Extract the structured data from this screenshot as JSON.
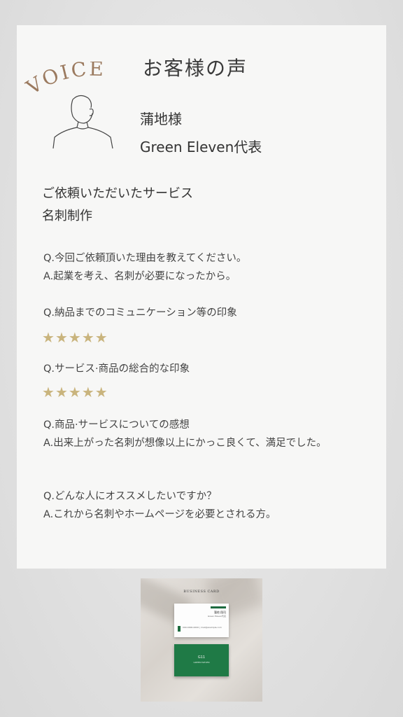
{
  "header": {
    "voice_label": "VOICE",
    "title": "お客様の声"
  },
  "customer": {
    "name": "蒲地様",
    "organization": "Green Eleven代表"
  },
  "service": {
    "label": "ご依頼いただいたサービス",
    "value": "名刺制作"
  },
  "qa": [
    {
      "question": "Q.今回ご依頼頂いた理由を教えてください。",
      "answer": "A.起業を考え、名刺が必要になったから。"
    },
    {
      "question": "Q.納品までのコミュニケーション等の印象",
      "rating": 5
    },
    {
      "question": "Q.サービス·商品の総合的な印象",
      "rating": 5
    },
    {
      "question": "Q.商品·サービスについての感想",
      "answer": "A.出来上がった名刺が想像以上にかっこ良くて、満足でした。"
    },
    {
      "question": "Q.どんな人にオススメしたいですか？",
      "answer": "A.これから名刺やホームページを必要とされる方。"
    }
  ],
  "rating_scale": 5,
  "star_glyph": "★",
  "photo": {
    "caption": "BUSINESS CARD",
    "front_name": "蒲地 翔司",
    "front_role": "Green Eleven代表",
    "front_info": "090-0000-0000 | mail@example.com",
    "back_mark": "G11",
    "back_sub": "GREEN ELEVEN"
  },
  "colors": {
    "star": "#c9b47d",
    "voice_text": "#9b7a5f",
    "card_green": "#1f7a46",
    "card_background": "#f7f7f6"
  },
  "icons": {
    "avatar": "person-outline-icon"
  }
}
